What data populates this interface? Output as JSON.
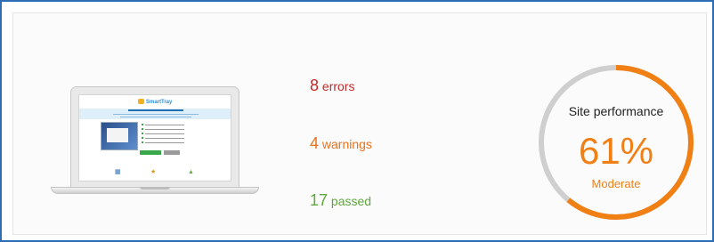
{
  "summary": {
    "errors": {
      "count": "8",
      "label": "errors",
      "color": "#c62828"
    },
    "warnings": {
      "count": "4",
      "label": "warnings",
      "color": "#e8721c"
    },
    "passed": {
      "count": "17",
      "label": "passed",
      "color": "#5fa83a"
    }
  },
  "performance": {
    "label": "Site performance",
    "value_text": "61%",
    "fraction": 0.61,
    "rating": "Moderate",
    "accent_color": "#f07f14",
    "track_color": "#cfcfcf"
  },
  "preview": {
    "icon": "laptop-icon",
    "site_logo_text": "SmartTray"
  }
}
